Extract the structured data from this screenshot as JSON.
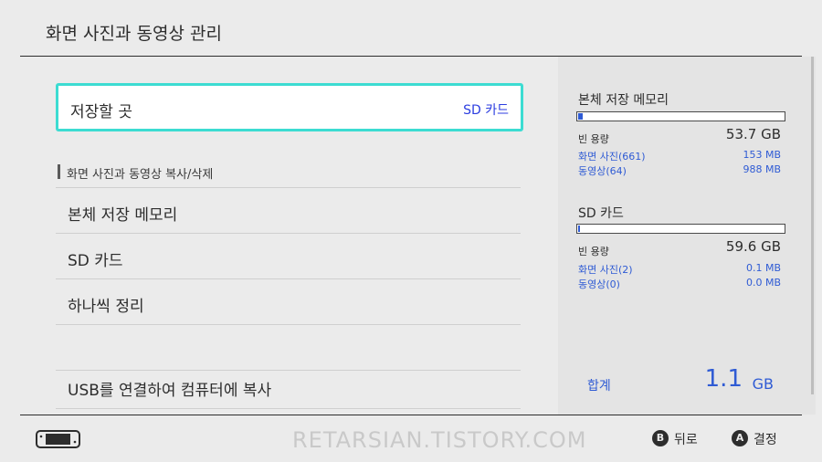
{
  "header": {
    "title": "화면 사진과 동영상 관리"
  },
  "save_destination": {
    "label": "저장할 곳",
    "value": "SD 카드"
  },
  "section": {
    "title": "화면 사진과 동영상 복사/삭제"
  },
  "menu_items": [
    {
      "label": "본체 저장 메모리"
    },
    {
      "label": "SD 카드"
    },
    {
      "label": "하나씩 정리"
    },
    {
      "label": ""
    },
    {
      "label": "USB를 연결하여 컴퓨터에 복사"
    }
  ],
  "storage": {
    "internal": {
      "title": "본체 저장 메모리",
      "usage_fraction": 0.02,
      "free_label": "빈 용량",
      "free_value": "53.7 GB",
      "screenshots_label": "화면 사진(661)",
      "screenshots_size": "153 MB",
      "videos_label": "동영상(64)",
      "videos_size": "988 MB"
    },
    "sd": {
      "title": "SD 카드",
      "usage_fraction": 0.005,
      "free_label": "빈 용량",
      "free_value": "59.6 GB",
      "screenshots_label": "화면 사진(2)",
      "screenshots_size": "0.1 MB",
      "videos_label": "동영상(0)",
      "videos_size": "0.0 MB"
    },
    "total": {
      "label": "합계",
      "value": "1.1",
      "unit": "GB"
    }
  },
  "footer": {
    "watermark": "RETARSIAN.TISTORY.COM",
    "back": {
      "key": "B",
      "label": "뒤로"
    },
    "confirm": {
      "key": "A",
      "label": "결정"
    }
  },
  "colors": {
    "accent": "#2f5bd4",
    "focus": "#3cdcd2"
  }
}
